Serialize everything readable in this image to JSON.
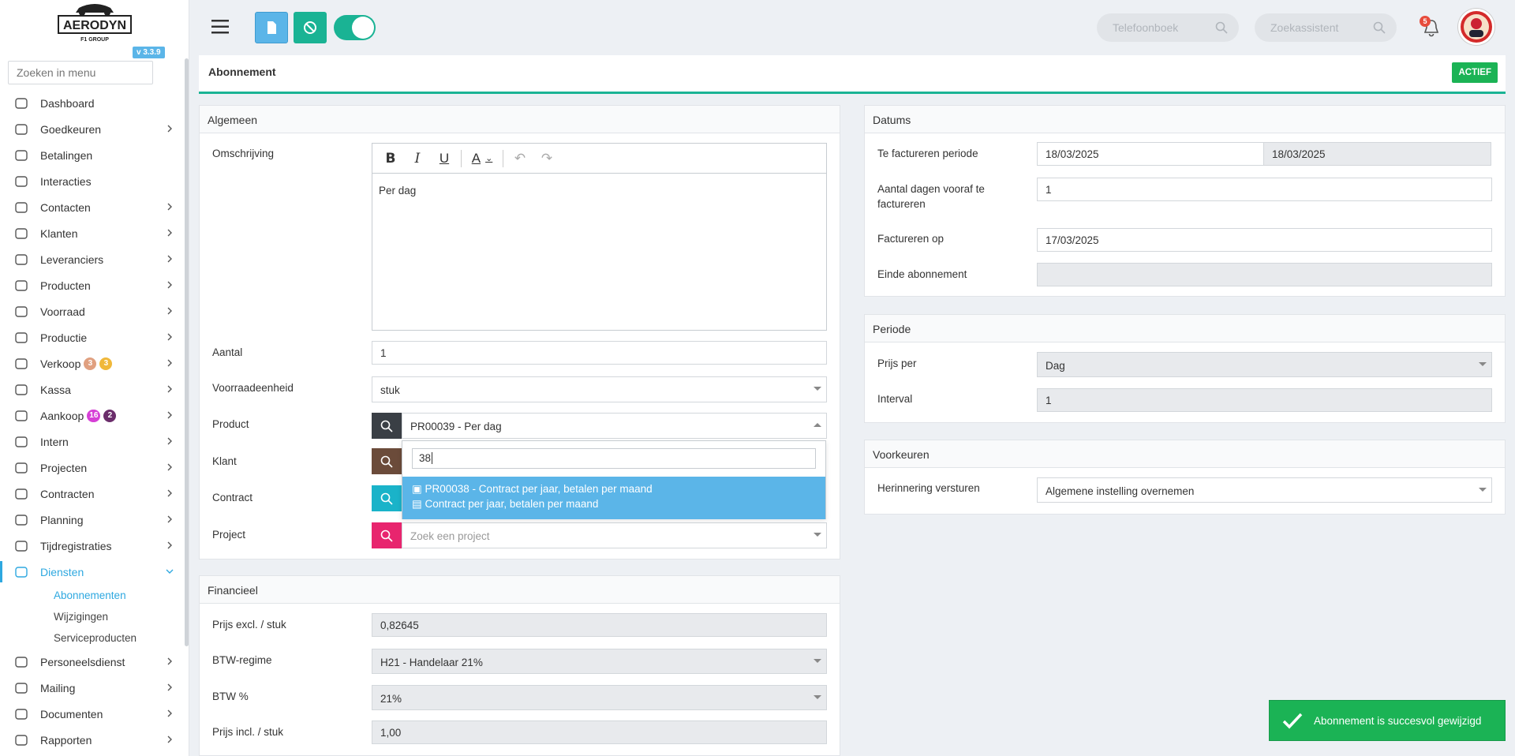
{
  "app": {
    "logo_text": "AERODYN",
    "logo_sub": "F1 GROUP",
    "version": "v 3.3.9"
  },
  "sidebar": {
    "search_placeholder": "Zoeken in menu",
    "items": [
      {
        "label": "Dashboard",
        "icon": "dashboard-icon",
        "chevron": false
      },
      {
        "label": "Goedkeuren",
        "icon": "user-check-icon",
        "chevron": true
      },
      {
        "label": "Betalingen",
        "icon": "credit-card-icon",
        "chevron": false
      },
      {
        "label": "Interacties",
        "icon": "chat-icon",
        "chevron": false
      },
      {
        "label": "Contacten",
        "icon": "contact-card-icon",
        "chevron": true
      },
      {
        "label": "Klanten",
        "icon": "customer-icon",
        "chevron": true
      },
      {
        "label": "Leveranciers",
        "icon": "truck-icon",
        "chevron": true
      },
      {
        "label": "Producten",
        "icon": "box-icon",
        "chevron": true
      },
      {
        "label": "Voorraad",
        "icon": "boxes-icon",
        "chevron": true
      },
      {
        "label": "Productie",
        "icon": "gears-icon",
        "chevron": true
      },
      {
        "label": "Verkoop",
        "icon": "euro-icon",
        "chevron": true,
        "badges": [
          {
            "text": "3",
            "color": "#e0a080"
          },
          {
            "text": "3",
            "color": "#f0b83a"
          }
        ]
      },
      {
        "label": "Kassa",
        "icon": "basket-icon",
        "chevron": true
      },
      {
        "label": "Aankoop",
        "icon": "cart-icon",
        "chevron": true,
        "badges": [
          {
            "text": "16",
            "color": "#d63fd6"
          },
          {
            "text": "2",
            "color": "#6b2d6b"
          }
        ]
      },
      {
        "label": "Intern",
        "icon": "users-icon",
        "chevron": true
      },
      {
        "label": "Projecten",
        "icon": "project-icon",
        "chevron": true
      },
      {
        "label": "Contracten",
        "icon": "contract-icon",
        "chevron": true
      },
      {
        "label": "Planning",
        "icon": "calendar-icon",
        "chevron": true
      },
      {
        "label": "Tijdregistraties",
        "icon": "timer-icon",
        "chevron": true
      },
      {
        "label": "Diensten",
        "icon": "refresh-icon",
        "chevron": true,
        "active": true
      }
    ],
    "sub_items": [
      {
        "label": "Abonnementen",
        "active": true
      },
      {
        "label": "Wijzigingen",
        "active": false
      },
      {
        "label": "Serviceproducten",
        "active": false
      }
    ],
    "items_after": [
      {
        "label": "Personeelsdienst",
        "icon": "personnel-icon"
      },
      {
        "label": "Mailing",
        "icon": "paper-plane-icon"
      },
      {
        "label": "Documenten",
        "icon": "folder-icon"
      },
      {
        "label": "Rapporten",
        "icon": "chart-line-icon"
      }
    ]
  },
  "topbar": {
    "phonebook_placeholder": "Telefoonboek",
    "assistant_placeholder": "Zoekassistent",
    "notification_count": "5",
    "colors": {
      "blue_btn": "#5bb5e8",
      "teal_btn": "#1ab394"
    }
  },
  "page": {
    "title": "Abonnement",
    "status": "ACTIEF"
  },
  "algemeen": {
    "heading": "Algemeen",
    "omschrijving_label": "Omschrijving",
    "omschrijving_value": "Per dag",
    "aantal_label": "Aantal",
    "aantal_value": "1",
    "voorraadeenheid_label": "Voorraadeenheid",
    "voorraadeenheid_value": "stuk",
    "product_label": "Product",
    "product_value": "PR00039 - Per dag",
    "klant_label": "Klant",
    "contract_label": "Contract",
    "project_label": "Project",
    "project_placeholder": "Zoek een project"
  },
  "dropdown": {
    "search_value": "38",
    "option_line1": "PR00038 - Contract per jaar, betalen per maand",
    "option_line2": "Contract per jaar, betalen per maand"
  },
  "financieel": {
    "heading": "Financieel",
    "prijs_excl_label": "Prijs excl. / stuk",
    "prijs_excl_value": "0,82645",
    "btw_regime_label": "BTW-regime",
    "btw_regime_value": "H21 - Handelaar 21%",
    "btw_pct_label": "BTW %",
    "btw_pct_value": "21%",
    "prijs_incl_label": "Prijs incl. / stuk",
    "prijs_incl_value": "1,00"
  },
  "datums": {
    "heading": "Datums",
    "periode_label": "Te factureren periode",
    "periode_from": "18/03/2025",
    "periode_to": "18/03/2025",
    "dagen_label": "Aantal dagen vooraf te factureren",
    "dagen_value": "1",
    "factureren_label": "Factureren op",
    "factureren_value": "17/03/2025",
    "einde_label": "Einde abonnement",
    "einde_value": ""
  },
  "periode": {
    "heading": "Periode",
    "prijs_per_label": "Prijs per",
    "prijs_per_value": "Dag",
    "interval_label": "Interval",
    "interval_value": "1"
  },
  "voorkeuren": {
    "heading": "Voorkeuren",
    "herinnering_label": "Herinnering versturen",
    "herinnering_value": "Algemene instelling overnemen"
  },
  "toast": {
    "message": "Abonnement is succesvol gewijzigd"
  }
}
